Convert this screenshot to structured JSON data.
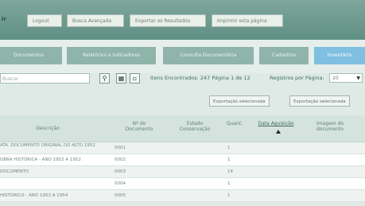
{
  "topbar": {
    "nav_glyph": "ir",
    "buttons": [
      "Logout",
      "Busca Avançada",
      "Exportar os Resultados",
      "Imprimir esta página"
    ]
  },
  "menu": {
    "tabs": [
      "Documentos",
      "Relatórios e Indicadores",
      "Consulta Documentária",
      "Cadastros",
      "Inventário"
    ],
    "active_index": 4
  },
  "search": {
    "placeholder": "Buscar",
    "results_text": "Itens Encontrados: 247  Página 1 de 12",
    "per_page_label": "Registros por Página:",
    "per_page_value": "20"
  },
  "export": {
    "buttons": [
      "Exportação selecionada",
      "Exportação selecionada"
    ]
  },
  "table": {
    "headers": {
      "descricao": "Descrição",
      "num_documento": "Nº do\nDocumento",
      "estado": "Estado\nConservação",
      "quant": "Quant.",
      "data_aquisicao": "Data Aquisição",
      "imagem": "Imagem do\ndocumento"
    },
    "rows": [
      {
        "descricao": "ATA. DOCUMENTO ORIGINAL DO ALTO 1952",
        "num": "0001",
        "quant": "1"
      },
      {
        "descricao": "OBRA HISTÓRICA - ANO 1952 A 1952",
        "num": "0002",
        "quant": "1"
      },
      {
        "descricao": "DOCUMENTO",
        "num": "0003",
        "quant": "14"
      },
      {
        "descricao": "",
        "num": "0004",
        "quant": "1"
      },
      {
        "descricao": "HISTÓRICO - ANO 1953 A 1954",
        "num": "0005",
        "quant": "1"
      }
    ]
  }
}
